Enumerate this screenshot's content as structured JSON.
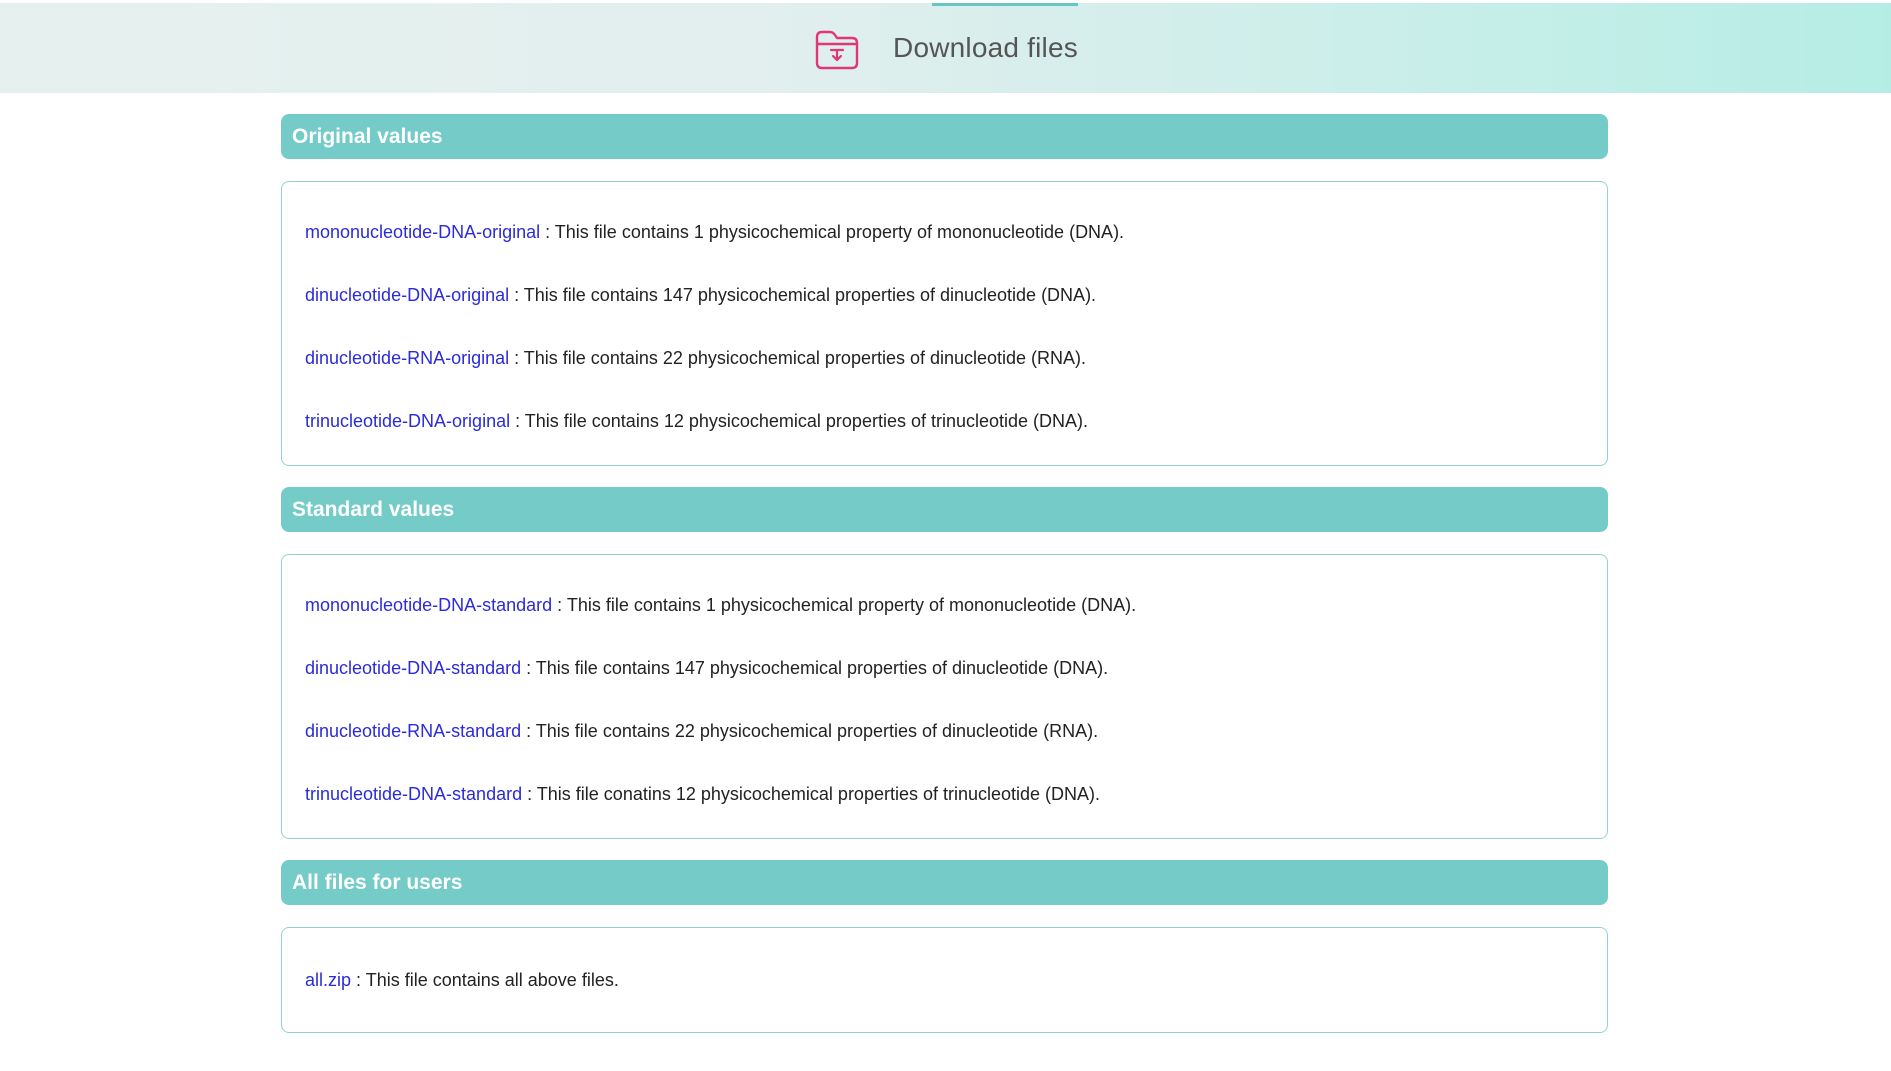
{
  "header": {
    "title": "Download files",
    "icon": "download-folder-icon",
    "icon_color": "#e0377a",
    "accent_color": "#66c7c4"
  },
  "sections": [
    {
      "title": "Original values",
      "files": [
        {
          "link": "mononucleotide-DNA-original",
          "desc": " : This file contains 1 physicochemical property of mononucleotide (DNA)."
        },
        {
          "link": "dinucleotide-DNA-original",
          "desc": " : This file contains 147 physicochemical properties of dinucleotide (DNA)."
        },
        {
          "link": "dinucleotide-RNA-original",
          "desc": " : This file contains 22 physicochemical properties of dinucleotide (RNA)."
        },
        {
          "link": "trinucleotide-DNA-original",
          "desc": " : This file contains 12 physicochemical properties of trinucleotide (DNA)."
        }
      ]
    },
    {
      "title": "Standard values",
      "files": [
        {
          "link": "mononucleotide-DNA-standard",
          "desc": " : This file contains 1 physicochemical property of mononucleotide (DNA)."
        },
        {
          "link": "dinucleotide-DNA-standard",
          "desc": " : This file contains 147 physicochemical properties of dinucleotide (DNA)."
        },
        {
          "link": "dinucleotide-RNA-standard",
          "desc": " : This file contains 22 physicochemical properties of dinucleotide (RNA)."
        },
        {
          "link": "trinucleotide-DNA-standard",
          "desc": " : This file conatins 12 physicochemical properties of trinucleotide (DNA)."
        }
      ]
    },
    {
      "title": "All files for users",
      "files": [
        {
          "link": "all.zip",
          "desc": " : This file contains all above files."
        }
      ]
    }
  ],
  "colors": {
    "section_bar": "#74cbc8",
    "link": "#2b2bd9",
    "box_border": "#8fd4d1"
  }
}
